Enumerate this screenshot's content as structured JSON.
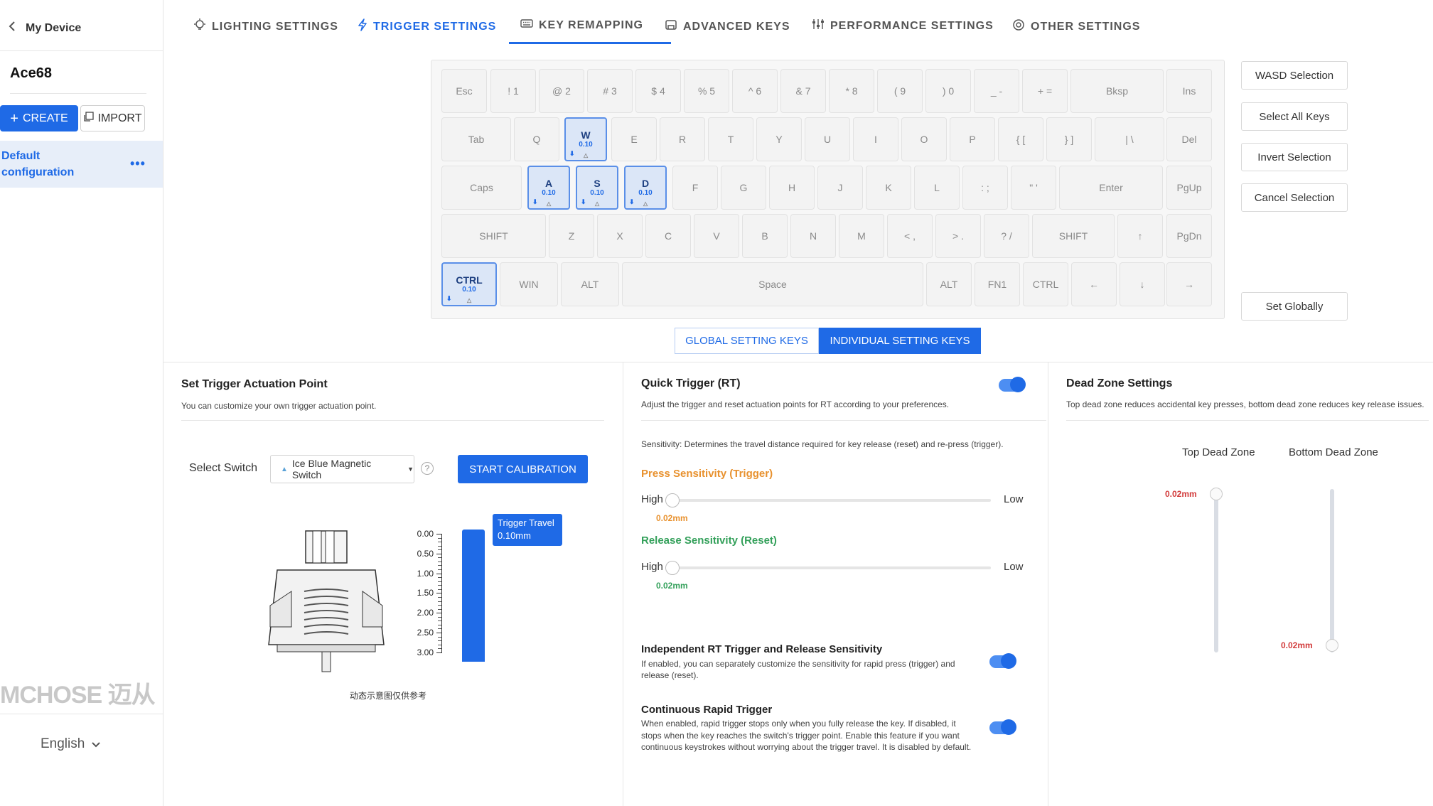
{
  "sidebar": {
    "back_label": "My Device",
    "device_name": "Ace68",
    "create_label": "CREATE",
    "import_label": "IMPORT",
    "config_name": "Default configuration",
    "more_label": "•••",
    "brand_logo": "MCHOSE 迈从",
    "language": "English"
  },
  "tabs": [
    {
      "label": "LIGHTING SETTINGS",
      "icon": "bulb-icon"
    },
    {
      "label": "TRIGGER SETTINGS",
      "icon": "lightning-icon",
      "active": true
    },
    {
      "label": "KEY REMAPPING",
      "icon": "keyboard-icon"
    },
    {
      "label": "ADVANCED KEYS",
      "icon": "advanced-keys-icon"
    },
    {
      "label": "PERFORMANCE SETTINGS",
      "icon": "sliders-icon"
    },
    {
      "label": "OTHER SETTINGS",
      "icon": "gear-icon"
    }
  ],
  "keyboard": {
    "rows": [
      [
        {
          "l": "Esc"
        },
        {
          "l": "! 1"
        },
        {
          "l": "@ 2"
        },
        {
          "l": "# 3"
        },
        {
          "l": "$ 4"
        },
        {
          "l": "% 5"
        },
        {
          "l": "^ 6"
        },
        {
          "l": "& 7"
        },
        {
          "l": "* 8"
        },
        {
          "l": "( 9"
        },
        {
          "l": ") 0"
        },
        {
          "l": "_ -"
        },
        {
          "l": "+ ="
        },
        {
          "l": "Bksp"
        },
        {
          "l": "Ins"
        }
      ],
      [
        {
          "l": "Tab"
        },
        {
          "l": "Q"
        },
        {
          "l": "W",
          "sel": true,
          "v": "0.10"
        },
        {
          "l": "E"
        },
        {
          "l": "R"
        },
        {
          "l": "T"
        },
        {
          "l": "Y"
        },
        {
          "l": "U"
        },
        {
          "l": "I"
        },
        {
          "l": "O"
        },
        {
          "l": "P"
        },
        {
          "l": "{ ["
        },
        {
          "l": "} ]"
        },
        {
          "l": "| \\"
        },
        {
          "l": "Del"
        }
      ],
      [
        {
          "l": "Caps"
        },
        {
          "l": "A",
          "sel": true,
          "v": "0.10"
        },
        {
          "l": "S",
          "sel": true,
          "v": "0.10"
        },
        {
          "l": "D",
          "sel": true,
          "v": "0.10"
        },
        {
          "l": "F"
        },
        {
          "l": "G"
        },
        {
          "l": "H"
        },
        {
          "l": "J"
        },
        {
          "l": "K"
        },
        {
          "l": "L"
        },
        {
          "l": ": ;"
        },
        {
          "l": "\" '"
        },
        {
          "l": "Enter"
        },
        {
          "l": "PgUp"
        }
      ],
      [
        {
          "l": "SHIFT"
        },
        {
          "l": "Z"
        },
        {
          "l": "X"
        },
        {
          "l": "C"
        },
        {
          "l": "V"
        },
        {
          "l": "B"
        },
        {
          "l": "N"
        },
        {
          "l": "M"
        },
        {
          "l": "< ,"
        },
        {
          "l": "> ."
        },
        {
          "l": "? /"
        },
        {
          "l": "SHIFT"
        },
        {
          "l": "↑"
        },
        {
          "l": "PgDn"
        }
      ],
      [
        {
          "l": "CTRL",
          "sel": true,
          "v": "0.10"
        },
        {
          "l": "WIN"
        },
        {
          "l": "ALT"
        },
        {
          "l": "Space"
        },
        {
          "l": "ALT"
        },
        {
          "l": "FN1"
        },
        {
          "l": "CTRL"
        },
        {
          "l": "←"
        },
        {
          "l": "↓"
        },
        {
          "l": "→"
        }
      ]
    ]
  },
  "selection_buttons": {
    "wasd": "WASD Selection",
    "select_all": "Select All Keys",
    "invert": "Invert Selection",
    "cancel": "Cancel Selection",
    "set_globally": "Set Globally"
  },
  "mode_toggle": {
    "global": "GLOBAL SETTING KEYS",
    "individual": "INDIVIDUAL SETTING KEYS"
  },
  "actuation": {
    "title": "Set Trigger Actuation Point",
    "desc": "You can customize your own trigger actuation point.",
    "select_label": "Select Switch",
    "switch_value": "Ice Blue Magnetic Switch",
    "calibrate": "START CALIBRATION",
    "scale_ticks": [
      "0.00",
      "0.50",
      "1.00",
      "1.50",
      "2.00",
      "2.50",
      "3.00"
    ],
    "tooltip_title": "Trigger Travel",
    "tooltip_value": "0.10mm",
    "caption": "动态示意图仅供参考"
  },
  "quick_trigger": {
    "title": "Quick Trigger (RT)",
    "enabled": true,
    "desc": "Adjust the trigger and reset actuation points for RT according to your preferences.",
    "sensitivity_desc": "Sensitivity: Determines the travel distance required for key release (reset) and re-press (trigger).",
    "press_title": "Press Sensitivity (Trigger)",
    "press_high": "High",
    "press_low": "Low",
    "press_value": "0.02mm",
    "release_title": "Release Sensitivity (Reset)",
    "release_high": "High",
    "release_low": "Low",
    "release_value": "0.02mm",
    "independent_title": "Independent RT Trigger and Release Sensitivity",
    "independent_desc": "If enabled, you can separately customize the sensitivity for rapid press (trigger) and release (reset).",
    "continuous_title": "Continuous Rapid Trigger",
    "continuous_desc": "When enabled, rapid trigger stops only when you fully release the key. If disabled, it stops when the key reaches the switch's trigger point. Enable this feature if you want continuous keystrokes without worrying about the trigger travel. It is disabled by default."
  },
  "dead_zone": {
    "title": "Dead Zone Settings",
    "desc": "Top dead zone reduces accidental key presses, bottom dead zone reduces key release issues.",
    "top_label": "Top Dead Zone",
    "bottom_label": "Bottom Dead Zone",
    "top_value": "0.02mm",
    "bottom_value": "0.02mm"
  },
  "colors": {
    "accent": "#1f6ae6",
    "press": "#e8912e",
    "release": "#33a05a",
    "deadzone": "#d23b3b"
  }
}
